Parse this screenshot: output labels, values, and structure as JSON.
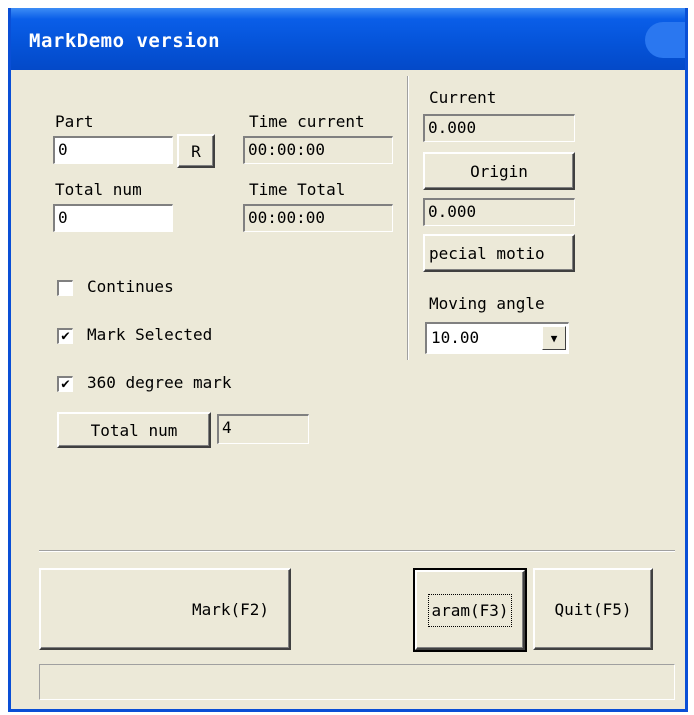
{
  "window": {
    "title": "MarkDemo version"
  },
  "left": {
    "part_label": "Part",
    "part_value": "0",
    "reset_button": "R",
    "total_num_label": "Total num",
    "total_num_value": "0",
    "time_current_label": "Time current",
    "time_current_value": "00:00:00",
    "time_total_label": "Time Total",
    "time_total_value": "00:00:00",
    "continues_label": "Continues",
    "continues_checked": false,
    "mark_selected_label": "Mark Selected",
    "mark_selected_checked": true,
    "degree360_label": "360 degree mark",
    "degree360_checked": true,
    "total_num_button": "Total num",
    "total_num_count": "4"
  },
  "right": {
    "current_label": "Current",
    "current_value": "0.000",
    "origin_button": "Origin",
    "origin_value": "0.000",
    "special_motion_button": "pecial motio",
    "moving_angle_label": "Moving angle",
    "moving_angle_value": "10.00"
  },
  "bottom": {
    "mark_button": "Mark(F2)",
    "param_button": "aram(F3)",
    "quit_button": "Quit(F5)"
  },
  "glyphs": {
    "check": "✔",
    "arrow_down": "▼"
  }
}
